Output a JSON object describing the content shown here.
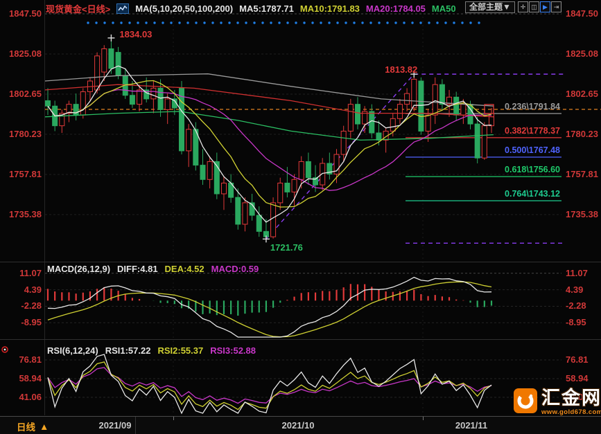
{
  "header": {
    "symbol": "现货黄金<日线>",
    "ma_group": "MA(5,10,20,50,100,200)",
    "ma5": "MA5:1787.71",
    "ma10": "MA10:1791.83",
    "ma20": "MA20:1784.05",
    "ma50": "MA50",
    "theme_dropdown": "全部主题▼",
    "toolbar_glyphs": [
      "✛",
      "◫",
      "▶",
      "⇥"
    ]
  },
  "colors": {
    "up": "#e23a3a",
    "down": "#2aa85f",
    "ma5": "#e8e8e8",
    "ma10": "#cfd032",
    "ma20": "#c837c8",
    "ma50": "#2bbf63",
    "ma100": "#d03030",
    "ma200": "#9a9a9a",
    "axis_text": "#d03838",
    "current_price_line": "#e08020",
    "trend_dashed": "#8a3cf0",
    "dotted_resistance": "#1f7fe8"
  },
  "main_panel": {
    "y_axis": [
      "1847.50",
      "1825.08",
      "1802.65",
      "1780.23",
      "1757.81",
      "1735.38"
    ],
    "annotations": [
      {
        "text": "1834.03",
        "color": "#e23a3a"
      },
      {
        "text": "1813.82",
        "color": "#e23a3a"
      },
      {
        "text": "1721.76",
        "color": "#2bbf63"
      }
    ]
  },
  "macd_panel": {
    "title": "MACD(26,12,9)",
    "diff_label": "DIFF:4.81",
    "dea_label": "DEA:4.52",
    "macd_label": "MACD:0.59",
    "y_axis": [
      "11.07",
      "4.39",
      "-2.28",
      "-8.95"
    ]
  },
  "rsi_panel": {
    "title": "RSI(6,12,24)",
    "rsi1_label": "RSI1:57.22",
    "rsi2_label": "RSI2:55.37",
    "rsi3_label": "RSI3:52.88",
    "y_axis": [
      "76.81",
      "58.94",
      "41.06"
    ]
  },
  "bottom_bar": {
    "tab_label": "日线",
    "tab_arrow": "▲",
    "months": [
      "2021/09",
      "2021/10",
      "2021/11"
    ]
  },
  "logo": {
    "name": "汇金网",
    "url": "www.gold678.com"
  },
  "chart_data": {
    "type": "candlestick",
    "symbol": "现货黄金 (Spot Gold)",
    "timeframe": "日线 (Daily)",
    "x_axis_months": [
      "2021/09",
      "2021/10",
      "2021/11"
    ],
    "price_ylim": [
      1721.76,
      1847.5
    ],
    "y_ticks": [
      1847.5,
      1825.08,
      1802.65,
      1780.23,
      1757.81,
      1735.38
    ],
    "current_price": 1791.84,
    "ma_values": {
      "ma5": 1787.71,
      "ma10": 1791.83,
      "ma20": 1784.05
    },
    "key_points": {
      "high": 1834.03,
      "high_idx": 9,
      "low": 1721.76,
      "low_idx": 31,
      "swing_high": 1813.82,
      "swing_idx": 52
    },
    "fib_levels": [
      {
        "label": "0.236\\1791.84",
        "ratio": 0.236,
        "price": 1791.84,
        "color": "#9a9a9a"
      },
      {
        "label": "0.382\\1778.37",
        "ratio": 0.382,
        "price": 1778.37,
        "color": "#e23a3a"
      },
      {
        "label": "0.500\\1767.48",
        "ratio": 0.5,
        "price": 1767.48,
        "color": "#4f63ff"
      },
      {
        "label": "0.618\\1756.60",
        "ratio": 0.618,
        "price": 1756.6,
        "color": "#1ecb6b"
      },
      {
        "label": "0.764\\1743.12",
        "ratio": 0.764,
        "price": 1743.12,
        "color": "#1ecb8f"
      }
    ],
    "candles_ohlc": [
      [
        1799,
        1806,
        1791,
        1796
      ],
      [
        1796,
        1799,
        1782,
        1785
      ],
      [
        1785,
        1794,
        1781,
        1792
      ],
      [
        1792,
        1799,
        1787,
        1797
      ],
      [
        1797,
        1803,
        1788,
        1791
      ],
      [
        1791,
        1806,
        1789,
        1804
      ],
      [
        1804,
        1812,
        1799,
        1810
      ],
      [
        1805,
        1826,
        1803,
        1824
      ],
      [
        1815,
        1830,
        1810,
        1828
      ],
      [
        1828,
        1834.03,
        1814,
        1817
      ],
      [
        1826,
        1829,
        1811,
        1813
      ],
      [
        1813,
        1817,
        1800,
        1802
      ],
      [
        1802,
        1810,
        1795,
        1797
      ],
      [
        1797,
        1808,
        1793,
        1805
      ],
      [
        1805,
        1812,
        1798,
        1800
      ],
      [
        1800,
        1810,
        1792,
        1806
      ],
      [
        1806,
        1811,
        1790,
        1794
      ],
      [
        1794,
        1803,
        1786,
        1800
      ],
      [
        1800,
        1805,
        1791,
        1795
      ],
      [
        1806,
        1810,
        1769,
        1771
      ],
      [
        1771,
        1786,
        1762,
        1783
      ],
      [
        1783,
        1787,
        1760,
        1763
      ],
      [
        1763,
        1772,
        1752,
        1755
      ],
      [
        1755,
        1768,
        1750,
        1765
      ],
      [
        1765,
        1770,
        1744,
        1747
      ],
      [
        1747,
        1757,
        1738,
        1753
      ],
      [
        1753,
        1758,
        1742,
        1745
      ],
      [
        1745,
        1750,
        1727,
        1730
      ],
      [
        1730,
        1745,
        1726,
        1742
      ],
      [
        1742,
        1747,
        1732,
        1735
      ],
      [
        1735,
        1740,
        1723,
        1726
      ],
      [
        1726,
        1733,
        1721.76,
        1723
      ],
      [
        1723,
        1745,
        1722,
        1742
      ],
      [
        1742,
        1756,
        1738,
        1753
      ],
      [
        1753,
        1762,
        1745,
        1748
      ],
      [
        1748,
        1758,
        1740,
        1755
      ],
      [
        1755,
        1768,
        1750,
        1765
      ],
      [
        1765,
        1770,
        1752,
        1756
      ],
      [
        1756,
        1763,
        1748,
        1752
      ],
      [
        1752,
        1767,
        1749,
        1764
      ],
      [
        1764,
        1770,
        1755,
        1758
      ],
      [
        1758,
        1772,
        1753,
        1769
      ],
      [
        1769,
        1785,
        1765,
        1782
      ],
      [
        1782,
        1800,
        1778,
        1797
      ],
      [
        1797,
        1801,
        1783,
        1786
      ],
      [
        1786,
        1796,
        1781,
        1793
      ],
      [
        1793,
        1797,
        1778,
        1781
      ],
      [
        1781,
        1788,
        1774,
        1777
      ],
      [
        1777,
        1784,
        1770,
        1782
      ],
      [
        1782,
        1792,
        1779,
        1789
      ],
      [
        1789,
        1800,
        1786,
        1797
      ],
      [
        1797,
        1806,
        1793,
        1803
      ],
      [
        1795,
        1813.82,
        1793,
        1811
      ],
      [
        1810,
        1812,
        1780,
        1782
      ],
      [
        1782,
        1794,
        1776,
        1791
      ],
      [
        1791,
        1812,
        1786,
        1808
      ],
      [
        1808,
        1811,
        1794,
        1797
      ],
      [
        1797,
        1805,
        1790,
        1801
      ],
      [
        1801,
        1804,
        1788,
        1791
      ],
      [
        1791,
        1800,
        1786,
        1797
      ],
      [
        1797,
        1799,
        1783,
        1786
      ],
      [
        1786,
        1790,
        1764,
        1767
      ],
      [
        1767,
        1787,
        1766,
        1785
      ],
      [
        1785,
        1795,
        1781,
        1791.84
      ]
    ],
    "ma_overlays": {
      "ma50": [
        [
          65,
          1790
        ],
        [
          170,
          1792
        ],
        [
          260,
          1793
        ],
        [
          343,
          1788
        ],
        [
          420,
          1782
        ],
        [
          520,
          1777
        ],
        [
          620,
          1778
        ],
        [
          712,
          1780
        ]
      ],
      "ma100": [
        [
          65,
          1805
        ],
        [
          170,
          1808
        ],
        [
          280,
          1806
        ],
        [
          420,
          1799
        ],
        [
          520,
          1792
        ],
        [
          620,
          1792
        ],
        [
          712,
          1790
        ]
      ],
      "ma200": [
        [
          65,
          1810
        ],
        [
          170,
          1813
        ],
        [
          300,
          1814
        ],
        [
          420,
          1807
        ],
        [
          550,
          1800
        ],
        [
          712,
          1796
        ]
      ]
    },
    "macd": {
      "params": [
        26,
        12,
        9
      ],
      "diff": 4.81,
      "dea": 4.52,
      "macd": 0.59,
      "y_ticks": [
        11.07,
        4.39,
        -2.28,
        -8.95
      ]
    },
    "rsi": {
      "params": [
        6,
        12,
        24
      ],
      "rsi1": 57.22,
      "rsi2": 55.37,
      "rsi3": 52.88,
      "y_ticks": [
        76.81,
        58.94,
        41.06
      ]
    }
  }
}
